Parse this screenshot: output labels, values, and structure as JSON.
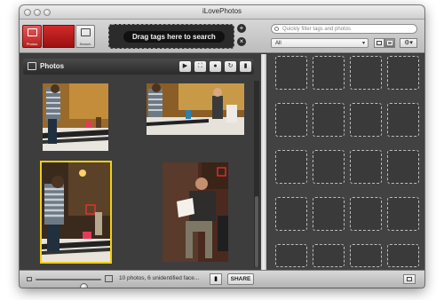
{
  "window": {
    "title": "iLovePhotos"
  },
  "toolbar": {
    "mode_left_label": "Photos",
    "mode_right_label": "Search",
    "drop_zone_label": "Drag tags here to search",
    "search_placeholder": "Quickly filter tags and photos",
    "filter_value": "All"
  },
  "photos_panel": {
    "title": "Photos"
  },
  "status": {
    "text": "10 photos, 6 unidentified face...",
    "share_label": "SHARE"
  },
  "colors": {
    "selection": "#f2cf13",
    "accent_red": "#c21d1d"
  },
  "icons": {
    "toolbar": [
      "photos-mode-icon",
      "search-mode-icon",
      "add-icon",
      "close-icon",
      "search-icon",
      "grid-view-icon",
      "gear-icon"
    ],
    "header": [
      "slideshow-icon",
      "fullscreen-icon",
      "person-icon",
      "rotate-icon",
      "trash-icon"
    ],
    "status": [
      "zoom-min-icon",
      "zoom-max-icon",
      "trash-icon",
      "panel-icon"
    ]
  }
}
